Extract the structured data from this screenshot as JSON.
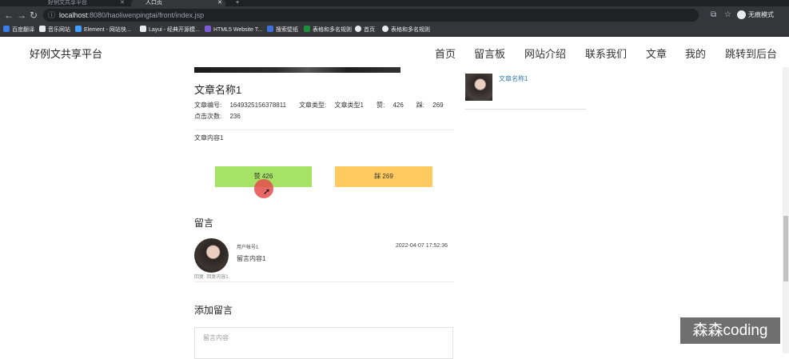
{
  "browser": {
    "tabs": [
      {
        "label": "好例文共享平台",
        "active": false
      },
      {
        "label": "人口页",
        "active": true
      }
    ],
    "new_tab": "+",
    "url": {
      "host": "localhost",
      "path": ":8080/haoliwenpingtai/front/index.jsp"
    },
    "incognito_label": "无痕模式",
    "bookmarks": [
      {
        "label": "百度翻译",
        "color": "#3b7be8"
      },
      {
        "label": "音乐网站",
        "color": "#e8eaed"
      },
      {
        "label": "Element - 网站快...",
        "color": "#409eff"
      },
      {
        "label": "Layui - 经典开源模...",
        "color": "#e8eaed"
      },
      {
        "label": "HTML5 Website T...",
        "color": "#7c5cd6"
      },
      {
        "label": "搜索壁纸",
        "color": "#3f6fd8"
      },
      {
        "label": "表格和多名规则",
        "color": "#1e8e3e"
      },
      {
        "label": "首页",
        "color": "#e8eaed"
      },
      {
        "label": "表格和多名规则",
        "color": "#e8eaed"
      }
    ]
  },
  "header": {
    "site_title": "好例文共享平台",
    "nav": [
      "首页",
      "留言板",
      "网站介绍",
      "联系我们",
      "文章",
      "我的",
      "跳转到后台"
    ]
  },
  "article": {
    "title": "文章名称1",
    "meta": {
      "number_label": "文章编号:",
      "number": "1649325156378811",
      "type_label": "文章类型:",
      "type": "文章类型1",
      "like_label": "赞:",
      "likes": "426",
      "dislike_label": "踩:",
      "dislikes": "269",
      "clicks_label": "点击次数:",
      "clicks": "236"
    },
    "content": "文章内容1",
    "like_button": "赞 426",
    "dislike_button": "踩 269"
  },
  "comments": {
    "heading": "留言",
    "items": [
      {
        "user": "用户帐号1",
        "time": "2022-04-07 17:52:36",
        "text": "留言内容1",
        "foot": "回复: 回复内容1"
      }
    ]
  },
  "add_comment": {
    "heading": "添加留言",
    "placeholder": "留言内容"
  },
  "sidebar": {
    "items": [
      {
        "label": "文章名称1"
      }
    ]
  },
  "watermark": "森森coding",
  "colors": {
    "like": "#a6e264",
    "dislike": "#ffcb60",
    "link": "#337ab7"
  }
}
